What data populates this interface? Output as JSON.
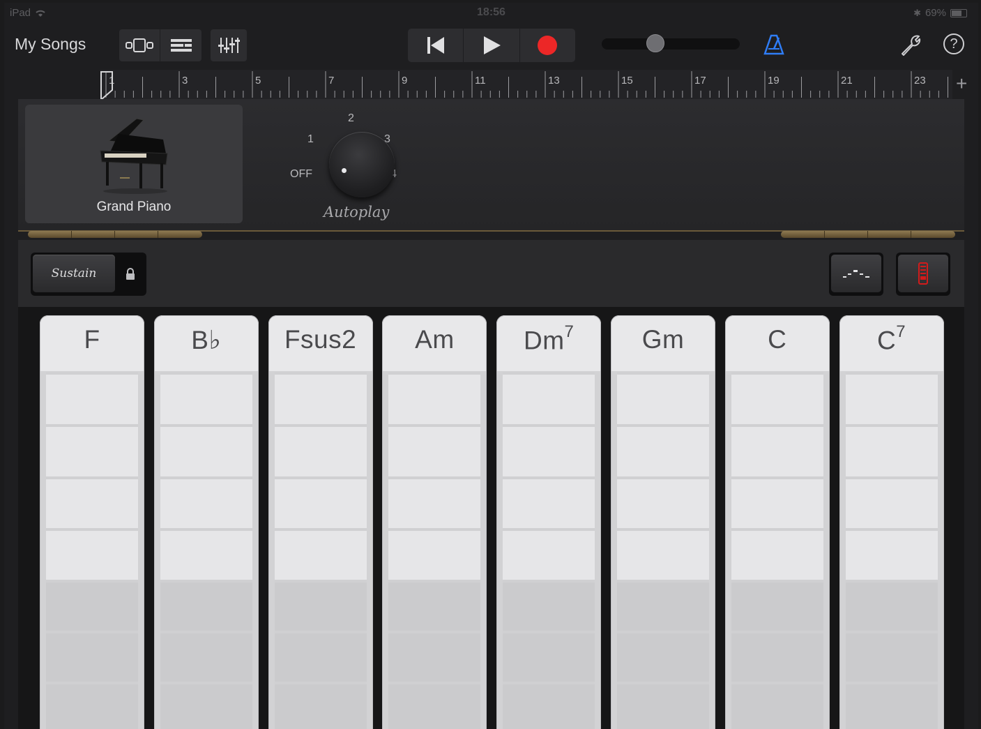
{
  "status": {
    "device": "iPad",
    "time": "18:56",
    "battery": "69%"
  },
  "toolbar": {
    "my_songs": "My Songs",
    "view_icons": [
      "tracks-view-icon",
      "tracks-list-icon"
    ],
    "mixer_icon": "mixer-icon",
    "transport": [
      "rewind-icon",
      "play-icon",
      "record-icon"
    ],
    "volume_level": 0.39,
    "metronome_icon": "metronome-icon",
    "settings_icon": "wrench-icon",
    "help_label": "?"
  },
  "ruler": {
    "bars": [
      "1",
      "3",
      "5",
      "7",
      "9",
      "11",
      "13",
      "15",
      "17",
      "19",
      "21",
      "23"
    ],
    "add_label": "+"
  },
  "instrument": {
    "name": "Grand Piano"
  },
  "autoplay": {
    "labels": {
      "off": "OFF",
      "one": "1",
      "two": "2",
      "three": "3",
      "four": "4"
    },
    "title": "Autoplay",
    "value": "OFF"
  },
  "controls": {
    "sustain": "Sustain",
    "lock_icon": "lock-icon",
    "arpeggio_icon": "chord-notes-icon",
    "strip_icon": "chord-strip-icon",
    "accent_color": "#d21b1b"
  },
  "chords": [
    {
      "root": "F",
      "sup": ""
    },
    {
      "root": "B♭",
      "sup": ""
    },
    {
      "root": "Fsus2",
      "sup": ""
    },
    {
      "root": "Am",
      "sup": ""
    },
    {
      "root": "Dm",
      "sup": "7"
    },
    {
      "root": "Gm",
      "sup": ""
    },
    {
      "root": "C",
      "sup": ""
    },
    {
      "root": "C",
      "sup": "7"
    }
  ]
}
